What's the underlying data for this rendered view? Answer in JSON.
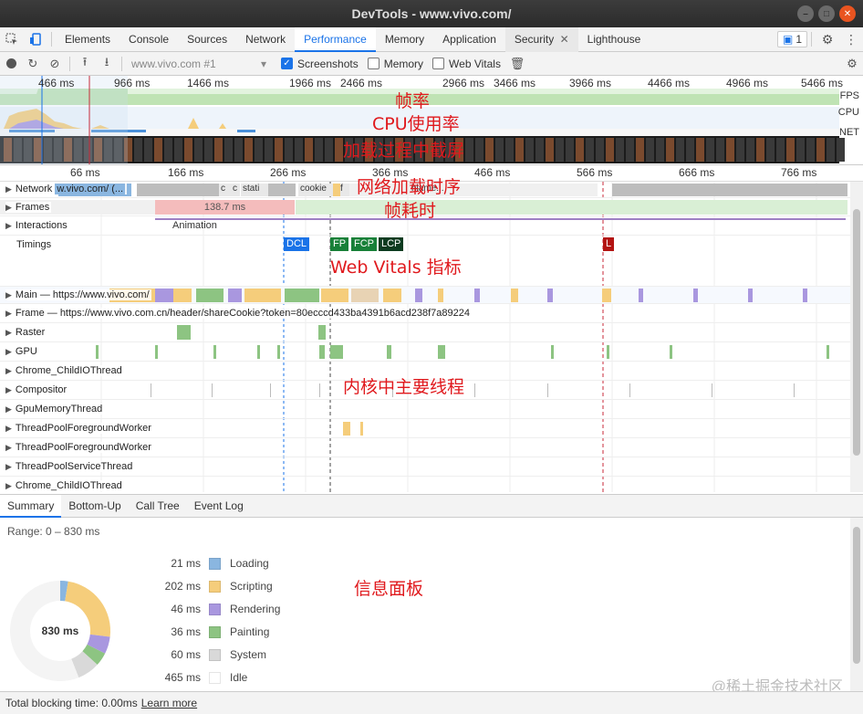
{
  "window": {
    "title": "DevTools - www.vivo.com/"
  },
  "tabs": [
    "Elements",
    "Console",
    "Sources",
    "Network",
    "Performance",
    "Memory",
    "Application",
    "Security",
    "Lighthouse"
  ],
  "tabs_active": "Performance",
  "issues_count": "1",
  "toolbar": {
    "url_select": "www.vivo.com #1",
    "screenshots_label": "Screenshots",
    "memory_label": "Memory",
    "webvitals_label": "Web Vitals"
  },
  "overview": {
    "ticks": [
      "466 ms",
      "966 ms",
      "1466 ms",
      "1966 ms",
      "2466 ms",
      "2966 ms",
      "3466 ms",
      "3966 ms",
      "4466 ms",
      "4966 ms",
      "5466 ms"
    ],
    "tags": {
      "fps": "FPS",
      "cpu": "CPU",
      "net": "NET"
    }
  },
  "flamechart": {
    "ticks": [
      "66 ms",
      "166 ms",
      "266 ms",
      "366 ms",
      "466 ms",
      "566 ms",
      "666 ms",
      "766 ms"
    ]
  },
  "tracks": {
    "network": "Network",
    "network_segments": [
      "w.vivo.com/ (...",
      "c",
      "c",
      "stati",
      "cookie",
      "f",
      "hlame..."
    ],
    "frames": "Frames",
    "frame_time": "138.7 ms",
    "interactions": "Interactions",
    "interaction_item": "Animation",
    "timings": "Timings",
    "markers": {
      "dcl": "DCL",
      "fp": "FP",
      "fcp": "FCP",
      "lcp": "LCP",
      "l": "L"
    },
    "main": "Main — https://www.vivo.com/",
    "frame": "Frame — https://www.vivo.com.cn/header/shareCookie?token=80ecccd433ba4391b6acd238f7a89224",
    "raster": "Raster",
    "gpu": "GPU",
    "chrome_io_1": "Chrome_ChildIOThread",
    "compositor": "Compositor",
    "gpumem": "GpuMemoryThread",
    "tpfw1": "ThreadPoolForegroundWorker",
    "tpfw2": "ThreadPoolForegroundWorker",
    "tpsw": "ThreadPoolServiceThread",
    "chrome_io_2": "Chrome_ChildIOThread"
  },
  "annotations": {
    "fps": "帧率",
    "cpu": "CPU使用率",
    "screenshots": "加载过程中截屏",
    "network": "网络加载时序",
    "frames": "帧耗时",
    "webvitals": "Web Vitals 指标",
    "threads": "内核中主要线程",
    "info": "信息面板"
  },
  "bottom_tabs": [
    "Summary",
    "Bottom-Up",
    "Call Tree",
    "Event Log"
  ],
  "bottom_tabs_active": "Summary",
  "summary": {
    "range": "Range: 0 – 830 ms",
    "total": "830 ms",
    "items": [
      {
        "ms": "21 ms",
        "name": "Loading",
        "color": "#8ab6e0",
        "value": 21
      },
      {
        "ms": "202 ms",
        "name": "Scripting",
        "color": "#f5cd7b",
        "value": 202
      },
      {
        "ms": "46 ms",
        "name": "Rendering",
        "color": "#a997df",
        "value": 46
      },
      {
        "ms": "36 ms",
        "name": "Painting",
        "color": "#8dc482",
        "value": 36
      },
      {
        "ms": "60 ms",
        "name": "System",
        "color": "#d9d9d9",
        "value": 60
      },
      {
        "ms": "465 ms",
        "name": "Idle",
        "color": "#ffffff",
        "value": 465
      }
    ]
  },
  "status": {
    "tbt": "Total blocking time: 0.00ms",
    "learn_more": "Learn more"
  },
  "watermark": "@稀土掘金技术社区"
}
